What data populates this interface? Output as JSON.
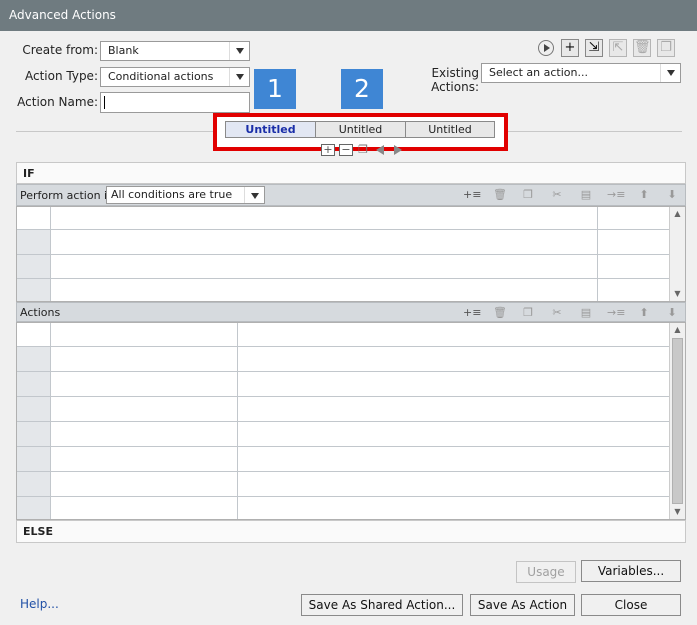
{
  "window": {
    "title": "Advanced Actions"
  },
  "form": {
    "create_from_label": "Create from:",
    "create_from_value": "Blank",
    "action_type_label": "Action Type:",
    "action_type_value": "Conditional actions",
    "action_name_label": "Action Name:",
    "action_name_value": "",
    "existing_actions_label": "Existing Actions:",
    "existing_actions_value": "Select an action..."
  },
  "callouts": {
    "one": "1",
    "two": "2"
  },
  "decision_tabs": [
    "Untitled",
    "Untitled",
    "Untitled"
  ],
  "toolbar_icons": [
    "preview-icon",
    "add-icon",
    "import-icon",
    "export-icon",
    "delete-icon",
    "duplicate-icon"
  ],
  "tab_tools": [
    "add-icon",
    "remove-icon",
    "copy-icon",
    "left-icon",
    "right-icon"
  ],
  "if_section": {
    "label": "IF",
    "perform_label": "Perform action if:",
    "condition_value": "All conditions are true"
  },
  "actions_section": {
    "label": "Actions"
  },
  "else_section": {
    "label": "ELSE"
  },
  "grid_tools": [
    "add-row-icon",
    "delete-row-icon",
    "copy-icon",
    "cut-icon",
    "paste-icon",
    "insert-icon",
    "move-up-icon",
    "move-down-icon"
  ],
  "buttons": {
    "usage": "Usage",
    "variables": "Variables...",
    "help": "Help...",
    "save_shared": "Save As Shared Action...",
    "save_action": "Save As Action",
    "close": "Close"
  },
  "colors": {
    "titlebar": "#6f7b80",
    "callout": "#3f86d4",
    "highlight": "#e10000",
    "active_tab": "#1a2ea8"
  }
}
